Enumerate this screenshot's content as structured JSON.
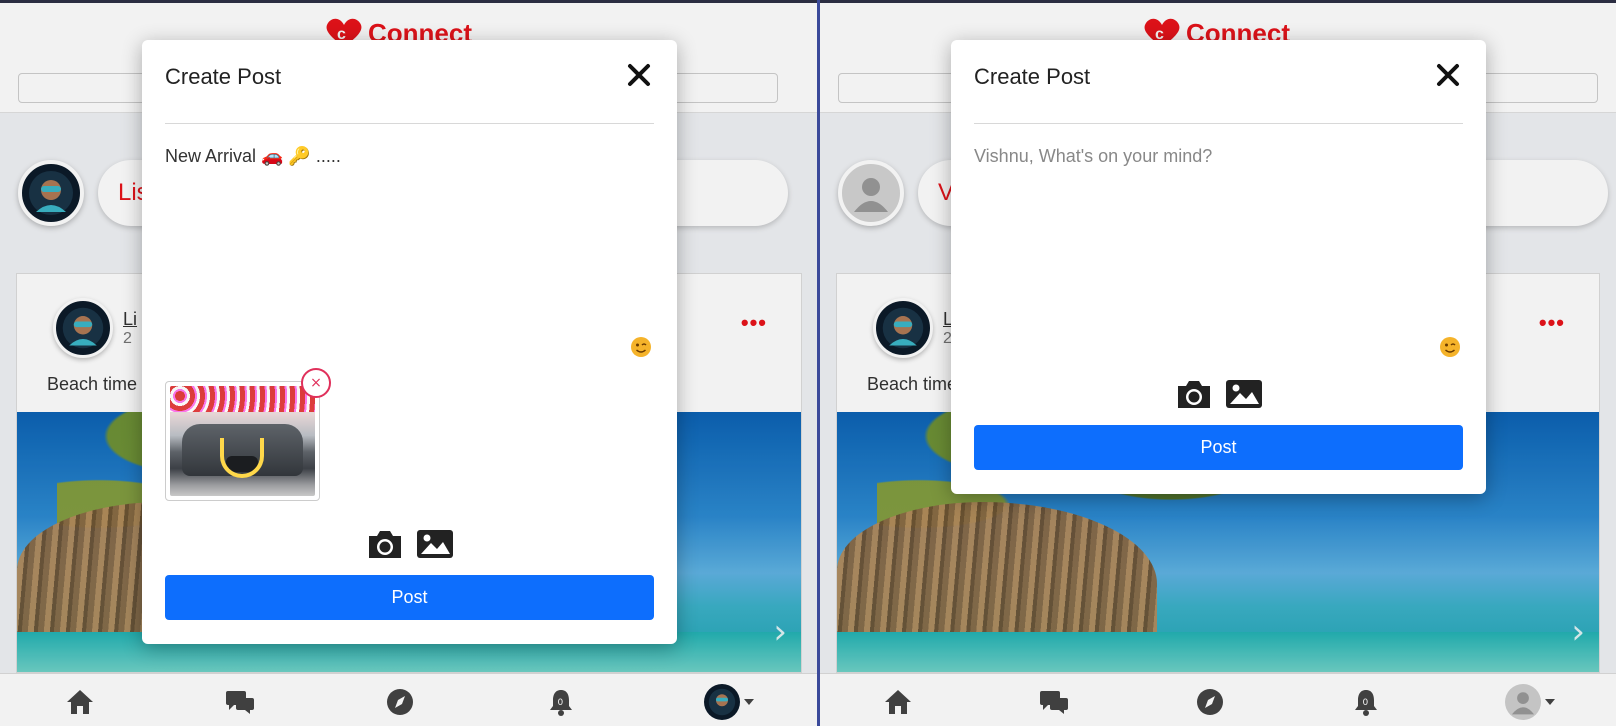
{
  "app": {
    "brand": "Connect"
  },
  "left_pane": {
    "composer_prompt": "Lisa",
    "feed": {
      "author": "Li",
      "time": "2",
      "caption": "Beach time",
      "more": "•••"
    },
    "modal": {
      "title": "Create Post",
      "text": "New Arrival 🚗 🔑 .....",
      "attachment_remove": "×",
      "post_label": "Post"
    }
  },
  "right_pane": {
    "composer_prompt": "Vis",
    "feed": {
      "author": "L",
      "time": "2",
      "caption": "Beach time",
      "more": "•••"
    },
    "modal": {
      "title": "Create Post",
      "placeholder": "Vishnu, What's on your mind?",
      "post_label": "Post"
    }
  },
  "colors": {
    "brand": "#e8141b",
    "primary": "#0d6efd",
    "remove": "#e0305b"
  },
  "icons": [
    "close-icon",
    "emoji-icon",
    "camera-icon",
    "image-icon",
    "home-icon",
    "chat-icon",
    "compass-icon",
    "bell-icon"
  ],
  "notification_badge": "0"
}
